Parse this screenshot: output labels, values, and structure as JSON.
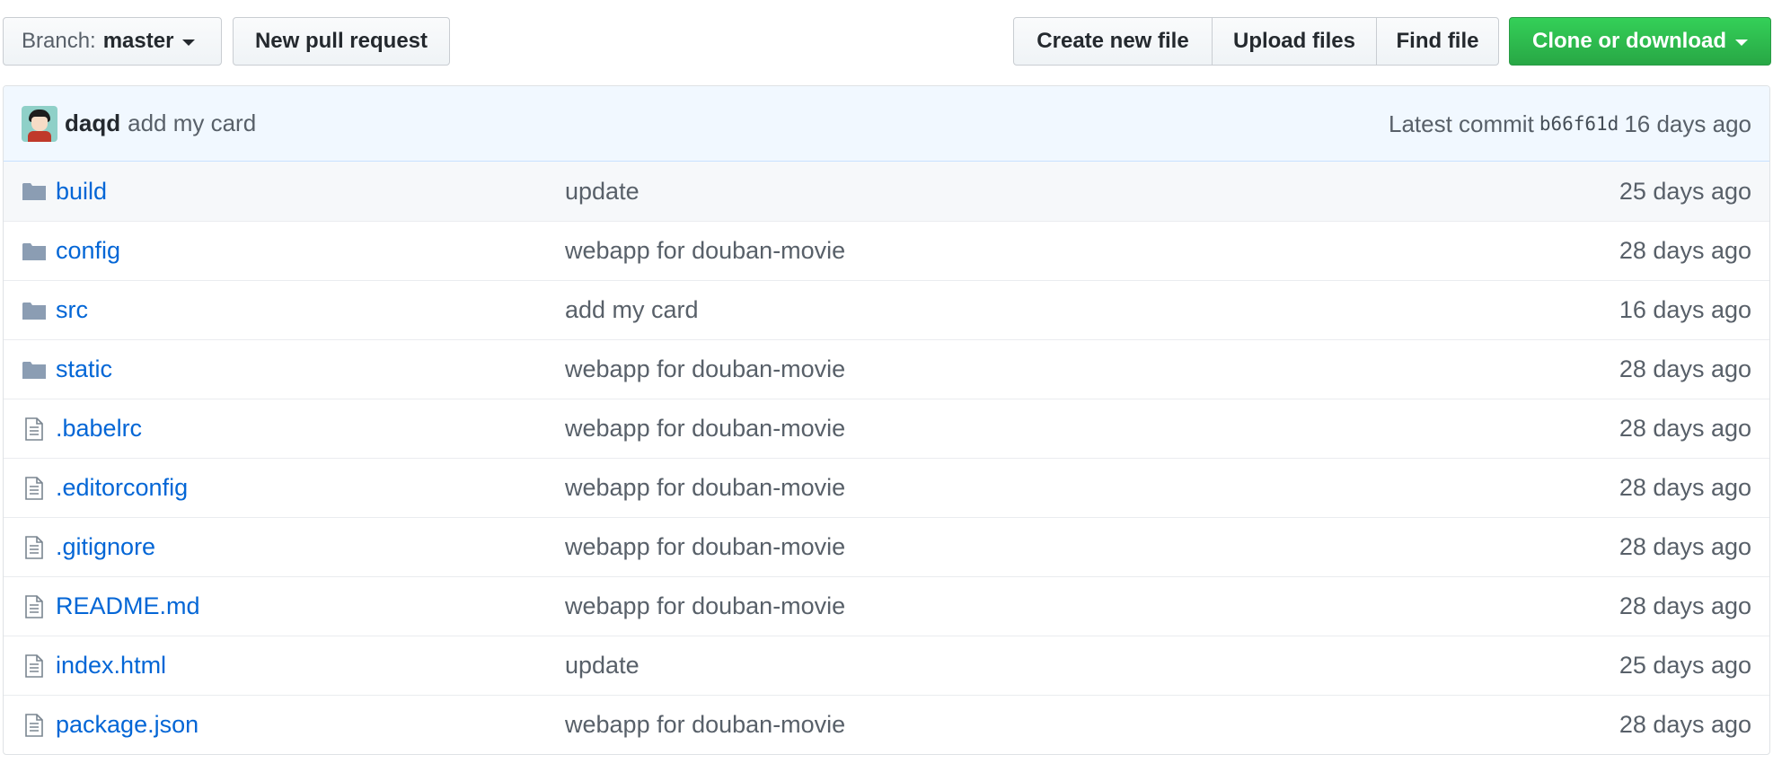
{
  "toolbar": {
    "branch_prefix": "Branch:",
    "branch_name": "master",
    "new_pull_request": "New pull request",
    "create_new_file": "Create new file",
    "upload_files": "Upload files",
    "find_file": "Find file",
    "clone_or_download": "Clone or download",
    "clone_color": "#2cbe4e"
  },
  "commit": {
    "author": "daqd",
    "message": "add my card",
    "latest_label": "Latest commit",
    "sha": "b66f61d",
    "age": "16 days ago"
  },
  "files": [
    {
      "name": "build",
      "type": "folder",
      "icon": "folder-icon",
      "message": "update",
      "age": "25 days ago"
    },
    {
      "name": "config",
      "type": "folder",
      "icon": "folder-icon",
      "message": "webapp for douban-movie",
      "age": "28 days ago"
    },
    {
      "name": "src",
      "type": "folder",
      "icon": "folder-icon",
      "message": "add my card",
      "age": "16 days ago"
    },
    {
      "name": "static",
      "type": "folder",
      "icon": "folder-icon",
      "message": "webapp for douban-movie",
      "age": "28 days ago"
    },
    {
      "name": ".babelrc",
      "type": "file",
      "icon": "file-icon",
      "message": "webapp for douban-movie",
      "age": "28 days ago"
    },
    {
      "name": ".editorconfig",
      "type": "file",
      "icon": "file-icon",
      "message": "webapp for douban-movie",
      "age": "28 days ago"
    },
    {
      "name": ".gitignore",
      "type": "file",
      "icon": "file-icon",
      "message": "webapp for douban-movie",
      "age": "28 days ago"
    },
    {
      "name": "README.md",
      "type": "file",
      "icon": "file-icon",
      "message": "webapp for douban-movie",
      "age": "28 days ago"
    },
    {
      "name": "index.html",
      "type": "file",
      "icon": "file-icon",
      "message": "update",
      "age": "25 days ago"
    },
    {
      "name": "package.json",
      "type": "file",
      "icon": "file-icon",
      "message": "webapp for douban-movie",
      "age": "28 days ago"
    }
  ],
  "colors": {
    "link": "#0366d6",
    "muted": "#586069",
    "folder_icon": "#79b8ff",
    "commit_bar_bg": "#f1f8ff"
  }
}
